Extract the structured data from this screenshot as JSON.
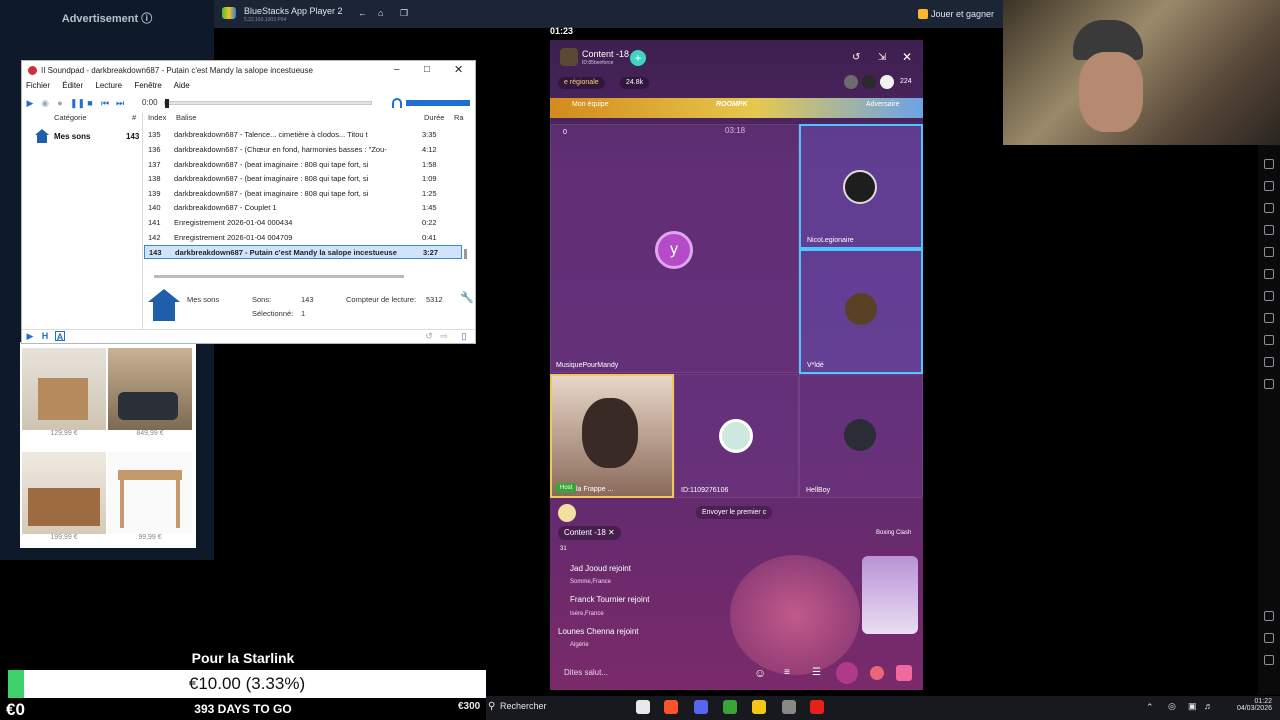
{
  "ad": {
    "title": "Advertisement ⓘ"
  },
  "products": [
    {
      "price": "129,99 €"
    },
    {
      "price": "849,99 €"
    },
    {
      "price": "199,99 €"
    },
    {
      "price": "99,99 €"
    }
  ],
  "bluestacks": {
    "title": "BlueStacks App Player 2",
    "subtitle": "5.22.160.1003  P64",
    "play_earn": "Jouer et gagner"
  },
  "soundpad": {
    "title": "II  Soundpad - darkbreakdown687 - Putain c'est Mandy la salope incestueuse",
    "menu": [
      "Fichier",
      "Éditer",
      "Lecture",
      "Fenêtre",
      "Aide"
    ],
    "time": "0:00",
    "cat_header": "Catégorie",
    "cat_hash": "#",
    "category": {
      "name": "Mes sons",
      "count": "143"
    },
    "columns": {
      "index": "Index",
      "tag": "Balise",
      "duration": "Durée",
      "rating": "Ra"
    },
    "rows": [
      {
        "index": "135",
        "name": "darkbreakdown687 - Talence... cimetière à clodos... Titou t",
        "duration": "3:35"
      },
      {
        "index": "136",
        "name": "darkbreakdown687 - (Chœur en fond, harmonies basses : \"Zou-",
        "duration": "4:12"
      },
      {
        "index": "137",
        "name": "darkbreakdown687 - (beat imaginaire : 808 qui tape fort, si",
        "duration": "1:58"
      },
      {
        "index": "138",
        "name": "darkbreakdown687 - (beat imaginaire : 808 qui tape fort, si",
        "duration": "1:09"
      },
      {
        "index": "139",
        "name": "darkbreakdown687 - (beat imaginaire : 808 qui tape fort, si",
        "duration": "1:25"
      },
      {
        "index": "140",
        "name": "darkbreakdown687 - Couplet 1",
        "duration": "1:45"
      },
      {
        "index": "141",
        "name": "Enregistrement 2026-01-04 000434",
        "duration": "0:22"
      },
      {
        "index": "142",
        "name": "Enregistrement 2026-01-04 004709",
        "duration": "0:41"
      },
      {
        "index": "143",
        "name": "darkbreakdown687 - Putain c'est Mandy la salope incestueuse",
        "duration": "3:27"
      }
    ],
    "info": {
      "name": "Mes sons",
      "sons_label": "Sons:",
      "sons_value": "143",
      "sel_label": "Sélectionné:",
      "sel_value": "1",
      "counter_label": "Compteur de lecture:",
      "counter_value": "5312"
    }
  },
  "phone": {
    "clock": "01:23",
    "room_title": "Content -18",
    "room_id": "ID:85benforce",
    "region": "e régionale",
    "likes": "24.8k",
    "viewers": "224",
    "my_team": "Mon équipe",
    "pk_logo": "ROOMPK",
    "opponent": "Adversaire",
    "timer": "03:18",
    "tiles": [
      {
        "num": "3",
        "label": "MusiquePourMandy",
        "initial": "y"
      },
      {
        "num": "1",
        "label": "NicoLegionaire"
      },
      {
        "num": "2",
        "label": "V*ldé"
      },
      {
        "num": "4",
        "label": "la Frappe ...",
        "host": "Host"
      },
      {
        "num": "4",
        "label": "ID:1109276106"
      },
      {
        "num": "5",
        "label": "HellBoy"
      }
    ],
    "send_first": "Envoyer le premier c",
    "chat_room": "Content -18",
    "chat_count": "31",
    "chat": [
      {
        "name": "Jad Jooud rejoint",
        "loc": "Somme,France"
      },
      {
        "name": "Franck Tournier rejoint",
        "loc": "Isère,France"
      },
      {
        "name": "Lounes Chenna rejoint",
        "loc": "Algérie"
      }
    ],
    "boxing": "Boxing Clash",
    "placeholder": "Dites salut..."
  },
  "donation": {
    "title": "Pour la Starlink",
    "value": "€10.00 (3.33%)",
    "progress": 0.0333,
    "zero": "€0",
    "days": "393 DAYS TO GO"
  },
  "taskbar": {
    "search": "Rechercher",
    "temp": "€300",
    "time": "01:22",
    "date": "04/03/2026"
  },
  "colors": {
    "accent": "#1f6fd1",
    "donation_fill": "#3fd16b",
    "phone_highlight": "#4fc6ff"
  }
}
